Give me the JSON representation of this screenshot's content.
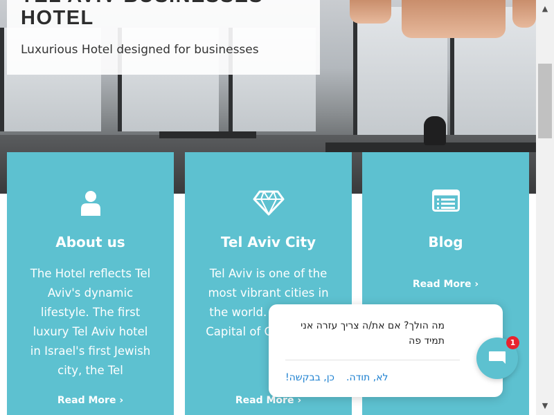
{
  "hero": {
    "title_top": "TEL AVIV BUSINESSES",
    "title": "HOTEL",
    "subtitle": "Luxurious Hotel designed for businesses"
  },
  "cards": [
    {
      "icon": "user-icon",
      "title": "About us",
      "text": "The Hotel reflects Tel Aviv's dynamic lifestyle. The first luxury Tel Aviv hotel in Israel's first Jewish city, the Tel",
      "more": "Read More"
    },
    {
      "icon": "diamond-icon",
      "title": "Tel Aviv City",
      "text": "Tel Aviv is one of the most vibrant cities in the world. ‘Mediter... Capital of C... New Y...",
      "more": "Read More"
    },
    {
      "icon": "list-icon",
      "title": "Blog",
      "text": "",
      "more": "Read More"
    }
  ],
  "chat": {
    "message": "מה הולך? אם את/ה צריך עזרה אני תמיד פה",
    "option_yes": "כן, בבקשה!",
    "option_no": "לא, תודה.",
    "badge_count": "1"
  },
  "colors": {
    "accent": "#5dc1d0",
    "badge": "#e8232e",
    "link": "#1a7fd0"
  }
}
